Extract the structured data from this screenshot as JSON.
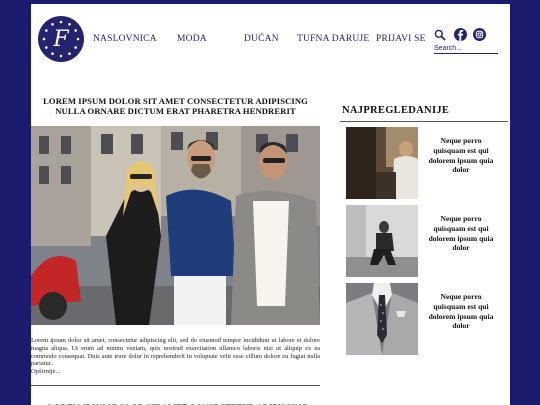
{
  "header": {
    "logo_letter": "F",
    "nav": [
      "NASLOVNICA",
      "MODA",
      "DUĆAN",
      "TUFNA DARUJE",
      "PRIJAVI SE"
    ],
    "search_placeholder": "Search...",
    "icons": [
      "search-icon",
      "facebook-icon",
      "instagram-icon"
    ]
  },
  "main": {
    "title": "LOREM IPSUM DOLOR SIT AMET CONSECTETUR ADIPISCING NULLA ORNARE DICTUM ERAT PHARETRA HENDRERIT",
    "excerpt": "Lorem ipsum dolor sit amet, consectetur adipiscing elit, sed do eiusmod tempor incididunt ut labore et dolore magna aliqua. Ut enim ad minim veniam, quis nostrud exercitation ullamco laboris nisi ut aliquip ex ea commodo consequat. Duis aute irure dolor in reprehenderit in voluptate velit esse cillum dolore eu fugiat nulla pariatur..",
    "read_more": "Opširnije...",
    "next_title": "LOREM IPSUM DOLOR SIT AMET CONSECTETUR ADIPISCING"
  },
  "sidebar": {
    "heading": "NAJPREGLEDANIJE",
    "items": [
      {
        "text": "Neque porro quisquam est qui dolorem ipsum quia dolor"
      },
      {
        "text": "Neque porro quisquam est qui dolorem ipsum quia dolor"
      },
      {
        "text": "Neque porro quisquam est qui dolorem ipsum quia dolor"
      }
    ]
  },
  "colors": {
    "brand": "#23236f",
    "background": "#1b1b6e"
  }
}
